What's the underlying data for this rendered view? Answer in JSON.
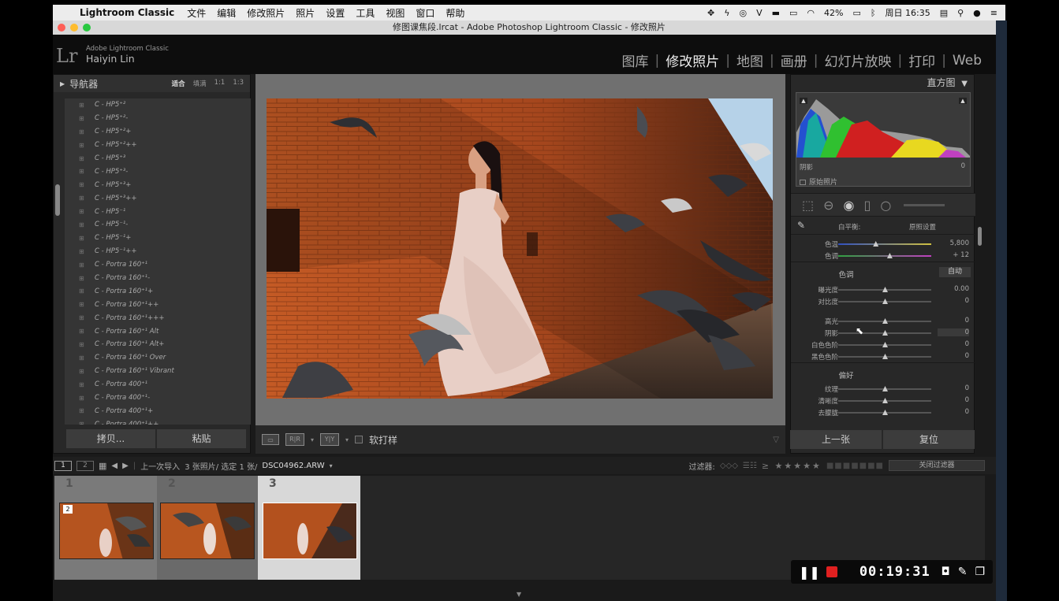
{
  "menubar": {
    "app_name": "Lightroom Classic",
    "menus": [
      "文件",
      "编辑",
      "修改照片",
      "照片",
      "设置",
      "工具",
      "视图",
      "窗口",
      "帮助"
    ],
    "battery": "42%",
    "clock": "周日 16:35"
  },
  "window": {
    "title": "修图课焦段.lrcat - Adobe Photoshop Lightroom Classic - 修改照片"
  },
  "identity": {
    "logo": "Lr",
    "product": "Adobe Lightroom Classic",
    "user": "Haiyin Lin"
  },
  "modules": [
    {
      "label": "图库",
      "active": false
    },
    {
      "label": "修改照片",
      "active": true
    },
    {
      "label": "地图",
      "active": false
    },
    {
      "label": "画册",
      "active": false
    },
    {
      "label": "幻灯片放映",
      "active": false
    },
    {
      "label": "打印",
      "active": false
    },
    {
      "label": "Web",
      "active": false
    }
  ],
  "navigator": {
    "title": "导航器",
    "zoom": [
      "适合",
      "填满",
      "1:1",
      "1:3"
    ]
  },
  "presets": [
    "C - HP5⁺²",
    "C - HP5⁺²-",
    "C - HP5⁺²+",
    "C - HP5⁺²++",
    "C - HP5⁺³",
    "C - HP5⁺³-",
    "C - HP5⁺³+",
    "C - HP5⁺³++",
    "C - HP5⁻¹",
    "C - HP5⁻¹-",
    "C - HP5⁻¹+",
    "C - HP5⁻¹++",
    "C - Portra 160⁺¹",
    "C - Portra 160⁺¹-",
    "C - Portra 160⁺¹+",
    "C - Portra 160⁺¹++",
    "C - Portra 160⁺¹+++",
    "C - Portra 160⁺¹ Alt",
    "C - Portra 160⁺¹ Alt+",
    "C - Portra 160⁺¹ Over",
    "C - Portra 160⁺¹ Vibrant",
    "C - Portra 400⁺¹",
    "C - Portra 400⁺¹-",
    "C - Portra 400⁺¹+",
    "C - Portra 400⁺¹++"
  ],
  "left_buttons": {
    "copy": "拷贝...",
    "paste": "粘贴"
  },
  "toolbar": {
    "soft_proof": "软打样"
  },
  "histogram": {
    "title": "直方图",
    "readout_label": "阴影",
    "readout_value": "0",
    "original": "原始照片"
  },
  "basic": {
    "wb_label": "白平衡:",
    "wb_value": "原照设置",
    "temp": {
      "label": "色温",
      "value": "5,800"
    },
    "tint": {
      "label": "色调",
      "value": "+ 12"
    },
    "tone_title": "色调",
    "auto": "自动",
    "exposure": {
      "label": "曝光度",
      "value": "0.00"
    },
    "contrast": {
      "label": "对比度",
      "value": "0"
    },
    "highlights": {
      "label": "高光",
      "value": "0"
    },
    "shadows": {
      "label": "阴影",
      "value": "0"
    },
    "whites": {
      "label": "白色色阶",
      "value": "0"
    },
    "blacks": {
      "label": "黑色色阶",
      "value": "0"
    },
    "presence_title": "偏好",
    "texture": {
      "label": "纹理",
      "value": "0"
    },
    "clarity": {
      "label": "清晰度",
      "value": "0"
    },
    "dehaze": {
      "label": "去朦胧",
      "value": "0"
    }
  },
  "right_buttons": {
    "previous": "上一张",
    "reset": "复位"
  },
  "filmstrip_bar": {
    "page1": "1",
    "page2": "2",
    "source": "上一次导入",
    "count": "3 张照片/ 选定 1 张/",
    "filename": "DSC04962.ARW",
    "filter_label": "过滤器:",
    "filter_value": "关闭过滤器"
  },
  "filmstrip": [
    {
      "num": "1",
      "badge": "2",
      "selected": false
    },
    {
      "num": "2",
      "badge": "",
      "selected": false
    },
    {
      "num": "3",
      "badge": "",
      "selected": true
    }
  ],
  "recording": {
    "time": "00:19:31"
  }
}
